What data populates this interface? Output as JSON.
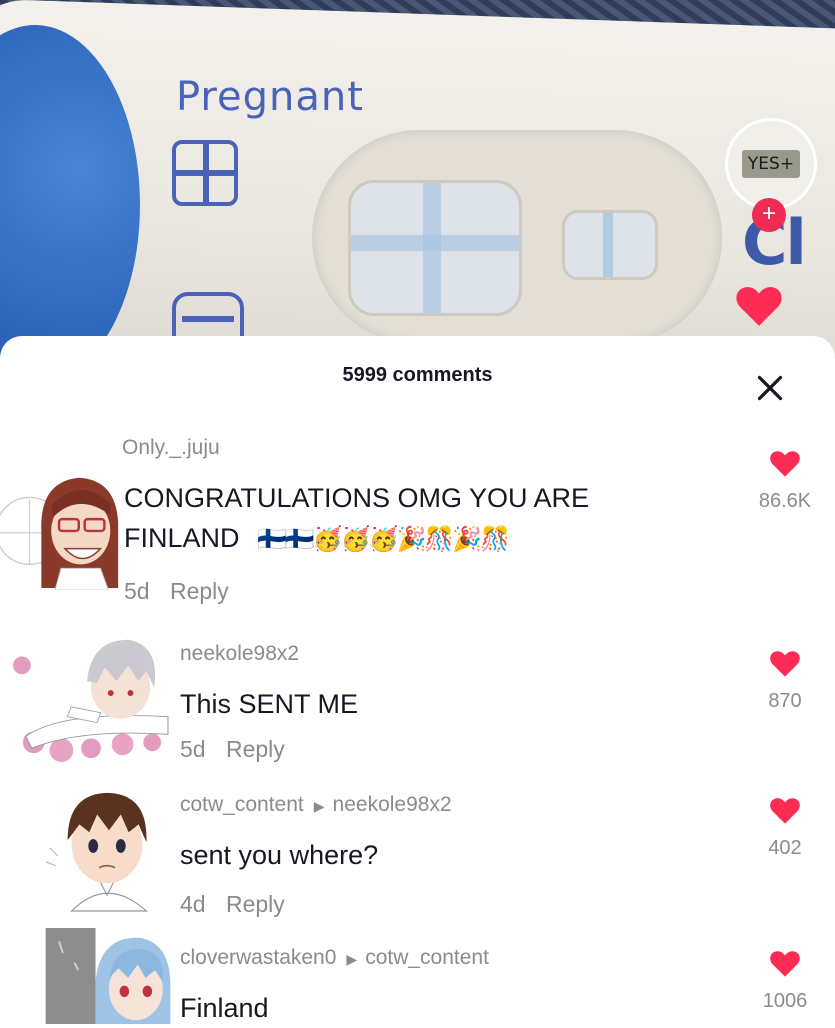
{
  "video": {
    "test_label": "Pregnant",
    "avatar_badge": "YES+",
    "partial_text": "Cl",
    "follow_symbol": "+"
  },
  "comments_panel": {
    "title": "5999 comments",
    "close_symbol": "✕"
  },
  "comments": [
    {
      "username": "Only._.juju",
      "text_line1": "CONGRATULATIONS OMG YOU ARE",
      "text_line2": "FINLAND",
      "emojis": "🇫🇮🇫🇮🥳🥳🥳🎉🎊🎉🎊",
      "age": "5d",
      "reply_label": "Reply",
      "likes": "86.6K"
    },
    {
      "username": "neekole98x2",
      "text": "This SENT ME",
      "age": "5d",
      "reply_label": "Reply",
      "likes": "870"
    },
    {
      "username": "cotw_content",
      "reply_to": "neekole98x2",
      "text": "sent you where?",
      "age": "4d",
      "reply_label": "Reply",
      "likes": "402"
    },
    {
      "username": "cloverwastaken0",
      "reply_to": "cotw_content",
      "text": "Finland",
      "likes": "1006"
    }
  ],
  "colors": {
    "like_red": "#fe2c55",
    "muted_text": "#8a8b91",
    "primary_text": "#161823",
    "test_blue": "#4b62b9"
  }
}
